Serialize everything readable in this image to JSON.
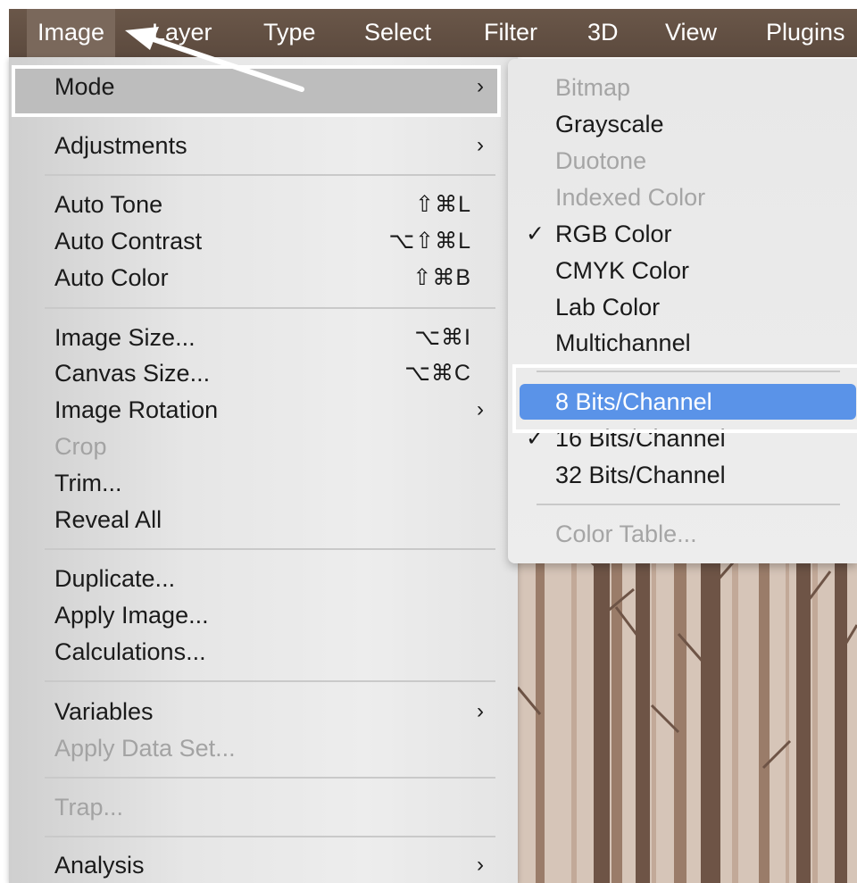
{
  "menubar": {
    "items": [
      "Image",
      "Layer",
      "Type",
      "Select",
      "Filter",
      "3D",
      "View",
      "Plugins"
    ]
  },
  "image_menu": {
    "mode": "Mode",
    "adjustments": "Adjustments",
    "auto_tone": "Auto Tone",
    "auto_tone_sc": "⇧⌘L",
    "auto_contrast": "Auto Contrast",
    "auto_contrast_sc": "⌥⇧⌘L",
    "auto_color": "Auto Color",
    "auto_color_sc": "⇧⌘B",
    "image_size": "Image Size...",
    "image_size_sc": "⌥⌘I",
    "canvas_size": "Canvas Size...",
    "canvas_size_sc": "⌥⌘C",
    "image_rotation": "Image Rotation",
    "crop": "Crop",
    "trim": "Trim...",
    "reveal_all": "Reveal All",
    "duplicate": "Duplicate...",
    "apply_image": "Apply Image...",
    "calculations": "Calculations...",
    "variables": "Variables",
    "apply_data_set": "Apply Data Set...",
    "trap": "Trap...",
    "analysis": "Analysis",
    "chevron": "›"
  },
  "mode_submenu": {
    "bitmap": "Bitmap",
    "grayscale": "Grayscale",
    "duotone": "Duotone",
    "indexed_color": "Indexed Color",
    "rgb_color": "RGB Color",
    "cmyk_color": "CMYK Color",
    "lab_color": "Lab Color",
    "multichannel": "Multichannel",
    "bits_8": "8 Bits/Channel",
    "bits_16": "16 Bits/Channel",
    "bits_32": "32 Bits/Channel",
    "color_table": "Color Table...",
    "checkmark": "✓"
  },
  "colors": {
    "menubar": "#5c4a3e",
    "highlight_blue": "#5a93e8",
    "annotation": "#ffffff"
  }
}
